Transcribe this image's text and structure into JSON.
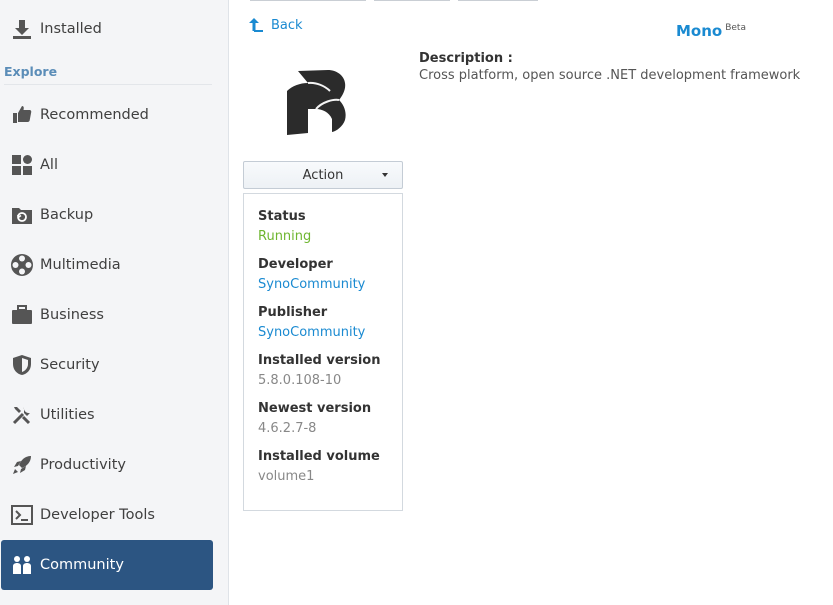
{
  "sidebar": {
    "installed": {
      "label": "Installed",
      "icon": "download-icon"
    },
    "section_label": "Explore",
    "items": [
      {
        "label": "Recommended",
        "icon": "thumbs-up-icon"
      },
      {
        "label": "All",
        "icon": "grid-icon"
      },
      {
        "label": "Backup",
        "icon": "backup-icon"
      },
      {
        "label": "Multimedia",
        "icon": "film-reel-icon"
      },
      {
        "label": "Business",
        "icon": "briefcase-icon"
      },
      {
        "label": "Security",
        "icon": "shield-icon"
      },
      {
        "label": "Utilities",
        "icon": "wrench-icon"
      },
      {
        "label": "Productivity",
        "icon": "rocket-icon"
      },
      {
        "label": "Developer Tools",
        "icon": "terminal-icon"
      },
      {
        "label": "Community",
        "icon": "people-icon",
        "active": true
      }
    ]
  },
  "main": {
    "back_label": "Back",
    "app_name": "Mono",
    "app_badge": "Beta",
    "description_label": "Description :",
    "description": "Cross platform, open source .NET development framework",
    "action_label": "Action",
    "info": {
      "status_label": "Status",
      "status_value": "Running",
      "developer_label": "Developer",
      "developer_value": "SynoCommunity",
      "publisher_label": "Publisher",
      "publisher_value": "SynoCommunity",
      "installed_version_label": "Installed version",
      "installed_version_value": "5.8.0.108-10",
      "newest_version_label": "Newest version",
      "newest_version_value": "4.6.2.7-8",
      "installed_volume_label": "Installed volume",
      "installed_volume_value": "volume1"
    }
  },
  "colors": {
    "accent": "#1a8ad1",
    "active_bg": "#2c5582",
    "running": "#6fb630",
    "section": "#5b8db8"
  }
}
